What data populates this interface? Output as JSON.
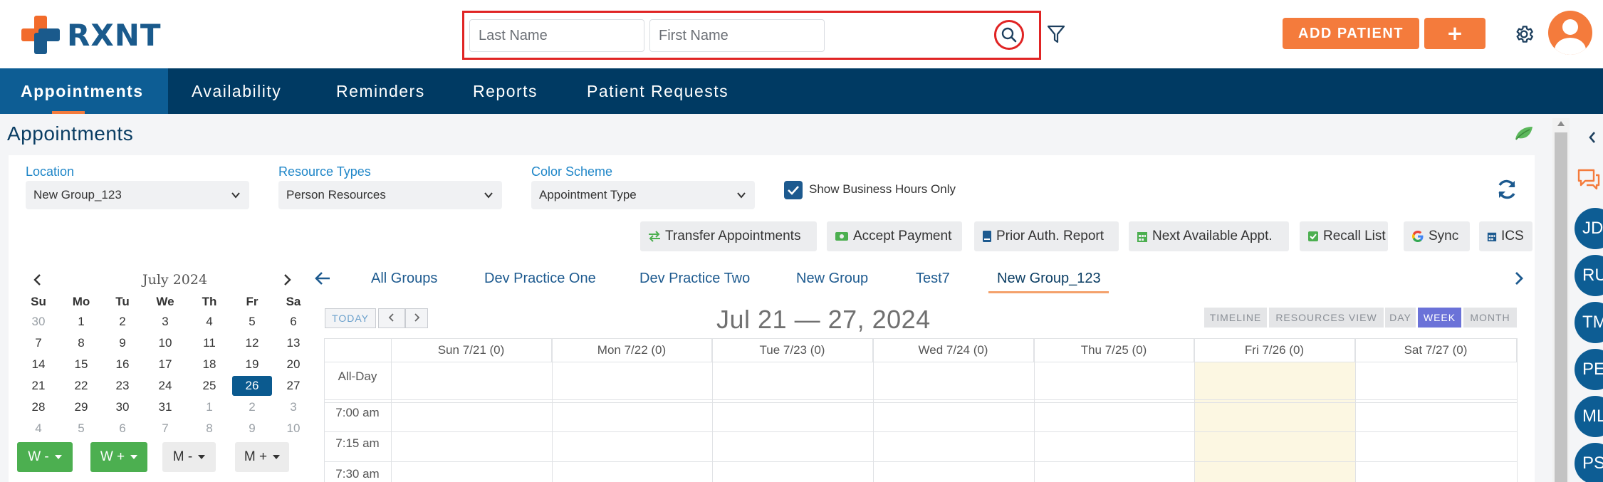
{
  "brand": {
    "name": "RXNT",
    "orange": "#f26b2b",
    "blue": "#1a5a8c"
  },
  "header": {
    "last_name_placeholder": "Last Name",
    "first_name_placeholder": "First Name",
    "add_patient_label": "ADD PATIENT",
    "plus_label": "+",
    "icons": [
      "search-icon",
      "filter-icon",
      "gear-icon",
      "avatar"
    ]
  },
  "nav": {
    "items": [
      {
        "label": "Appointments",
        "active": true
      },
      {
        "label": "Availability"
      },
      {
        "label": "Reminders"
      },
      {
        "label": "Reports"
      },
      {
        "label": "Patient Requests"
      }
    ]
  },
  "page": {
    "title": "Appointments"
  },
  "filters": {
    "location_label": "Location",
    "location_value": "New Group_123",
    "resource_types_label": "Resource Types",
    "resource_types_value": "Person Resources",
    "color_scheme_label": "Color Scheme",
    "color_scheme_value": "Appointment Type",
    "business_hours_label": "Show Business Hours Only",
    "business_hours_checked": true
  },
  "toolbar": {
    "buttons": [
      {
        "label": "Transfer Appointments",
        "icon": "transfer-icon"
      },
      {
        "label": "Accept Payment",
        "icon": "payment-icon"
      },
      {
        "label": "Prior Auth. Report",
        "icon": "report-icon"
      },
      {
        "label": "Next Available Appt.",
        "icon": "calendar-icon"
      },
      {
        "label": "Recall List",
        "icon": "recall-icon"
      },
      {
        "label": "Sync",
        "icon": "google-icon"
      },
      {
        "label": "ICS",
        "icon": "calendar-icon"
      }
    ]
  },
  "mini_calendar": {
    "month": "July 2024",
    "days_of_week": [
      "Su",
      "Mo",
      "Tu",
      "We",
      "Th",
      "Fr",
      "Sa"
    ],
    "weeks": [
      [
        "30",
        "1",
        "2",
        "3",
        "4",
        "5",
        "6"
      ],
      [
        "7",
        "8",
        "9",
        "10",
        "11",
        "12",
        "13"
      ],
      [
        "14",
        "15",
        "16",
        "17",
        "18",
        "19",
        "20"
      ],
      [
        "21",
        "22",
        "23",
        "24",
        "25",
        "26",
        "27"
      ],
      [
        "28",
        "29",
        "30",
        "31",
        "1",
        "2",
        "3"
      ],
      [
        "4",
        "5",
        "6",
        "7",
        "8",
        "9",
        "10"
      ]
    ],
    "selected_day": "26",
    "week_buttons": [
      {
        "label": "W -",
        "style": "green"
      },
      {
        "label": "W +",
        "style": "green"
      },
      {
        "label": "M -",
        "style": "gray"
      },
      {
        "label": "M +",
        "style": "gray"
      }
    ]
  },
  "group_tabs": {
    "items": [
      "All Groups",
      "Dev Practice One",
      "Dev Practice Two",
      "New Group",
      "Test7",
      "New Group_123"
    ],
    "active": "New Group_123"
  },
  "week_view": {
    "today_label": "TODAY",
    "title": "Jul 21 — 27, 2024",
    "views": [
      {
        "label": "TIMELINE"
      },
      {
        "label": "RESOURCES VIEW"
      },
      {
        "label": "DAY"
      },
      {
        "label": "WEEK",
        "active": true
      },
      {
        "label": "MONTH"
      }
    ],
    "columns": [
      "Sun 7/21 (0)",
      "Mon 7/22 (0)",
      "Tue 7/23 (0)",
      "Wed 7/24 (0)",
      "Thu 7/25 (0)",
      "Fri 7/26 (0)",
      "Sat 7/27 (0)"
    ],
    "all_day_label": "All-Day",
    "times": [
      "7:00 am",
      "7:15 am",
      "7:30 am"
    ]
  },
  "right_panel": {
    "users": [
      "JD",
      "RU",
      "TM",
      "PE",
      "ML",
      "PS"
    ]
  }
}
